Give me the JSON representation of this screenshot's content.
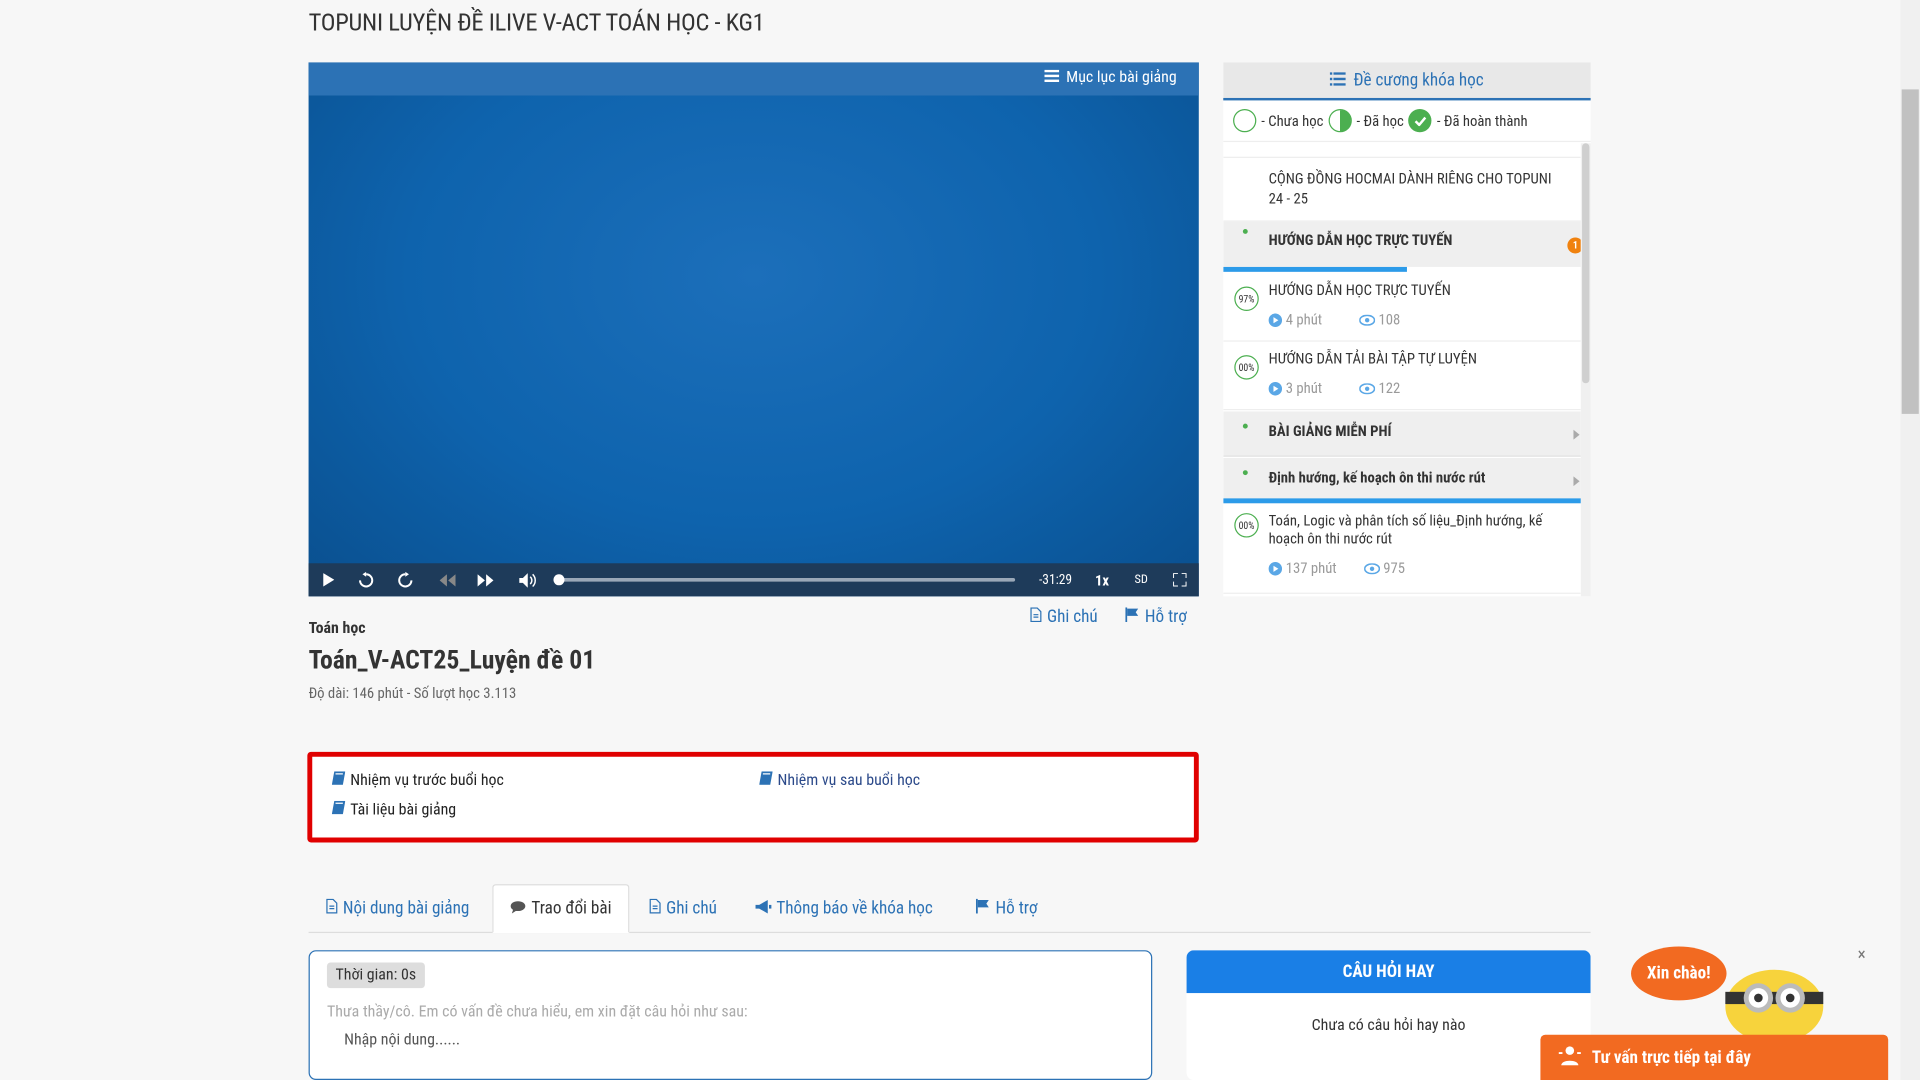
{
  "page": {
    "title": "TOPUNI LUYỆN ĐỀ ILIVE V-ACT TOÁN HỌC - KG1"
  },
  "player": {
    "toc_label": "Mục lục bài giảng",
    "time_remaining": "-31:29",
    "speed": "1x",
    "quality": "SD",
    "progress": 0.0
  },
  "outline": {
    "title": "Đề cương khóa học",
    "legend": {
      "not_learned": "- Chưa học",
      "learned": "- Đã học",
      "completed": "- Đã hoàn thành"
    },
    "items": [
      {
        "text": "CỘNG ĐỒNG HOCMAI DÀNH RIÊNG CHO TOPUNI 24 - 25"
      },
      {
        "text": "HƯỚNG DẪN HỌC TRỰC TUYẾN",
        "badge": "1"
      },
      {
        "text": "HƯỚNG DẪN HỌC TRỰC TUYẾN",
        "percent": "97%",
        "duration": "4 phút",
        "views": "108"
      },
      {
        "text": "HƯỚNG DẪN TẢI BÀI TẬP TỰ LUYỆN",
        "percent": "00%",
        "duration": "3 phút",
        "views": "122"
      },
      {
        "text": "BÀI GIẢNG MIỄN PHÍ"
      },
      {
        "text": "Định hướng, kế hoạch ôn thi nước rút"
      },
      {
        "text_line1": "Toán, Logic và phân tích số liệu_Định hướng, kế",
        "text_line2": "hoạch ôn thi nước rút",
        "percent": "00%",
        "duration": "137 phút",
        "views": "975"
      }
    ]
  },
  "actions": {
    "note": "Ghi chú",
    "support": "Hỗ trợ"
  },
  "lesson": {
    "subject": "Toán học",
    "name": "Toán_V-ACT25_Luyện đề 01",
    "duration": "Độ dài: 146 phút - Số lượt học 3.113"
  },
  "tasks": {
    "before": "Nhiệm vụ trước buổi học",
    "after": "Nhiệm vụ sau buổi học",
    "docs": "Tài liệu bài giảng"
  },
  "tabs": [
    "Nội dung bài giảng",
    "Trao đổi bài",
    "Ghi chú",
    "Thông báo về khóa học",
    "Hỗ trợ"
  ],
  "question": {
    "time": "Thời gian: 0s",
    "hint": "Thưa thầy/cô. Em có vấn đề chưa hiểu, em xin đặt câu hỏi như sau:",
    "placeholder": "Nhập nội dung......"
  },
  "hot_questions": {
    "title": "CÂU HỎI HAY",
    "empty": "Chưa có câu hỏi hay nào"
  },
  "chat": {
    "greeting": "Xin chào!",
    "label": "Tư vấn trực tiếp tại đây",
    "close": "×"
  },
  "colors": {
    "accent": "#2c72b5",
    "highlight_red": "#e00000",
    "chat_orange": "#f26a21"
  }
}
